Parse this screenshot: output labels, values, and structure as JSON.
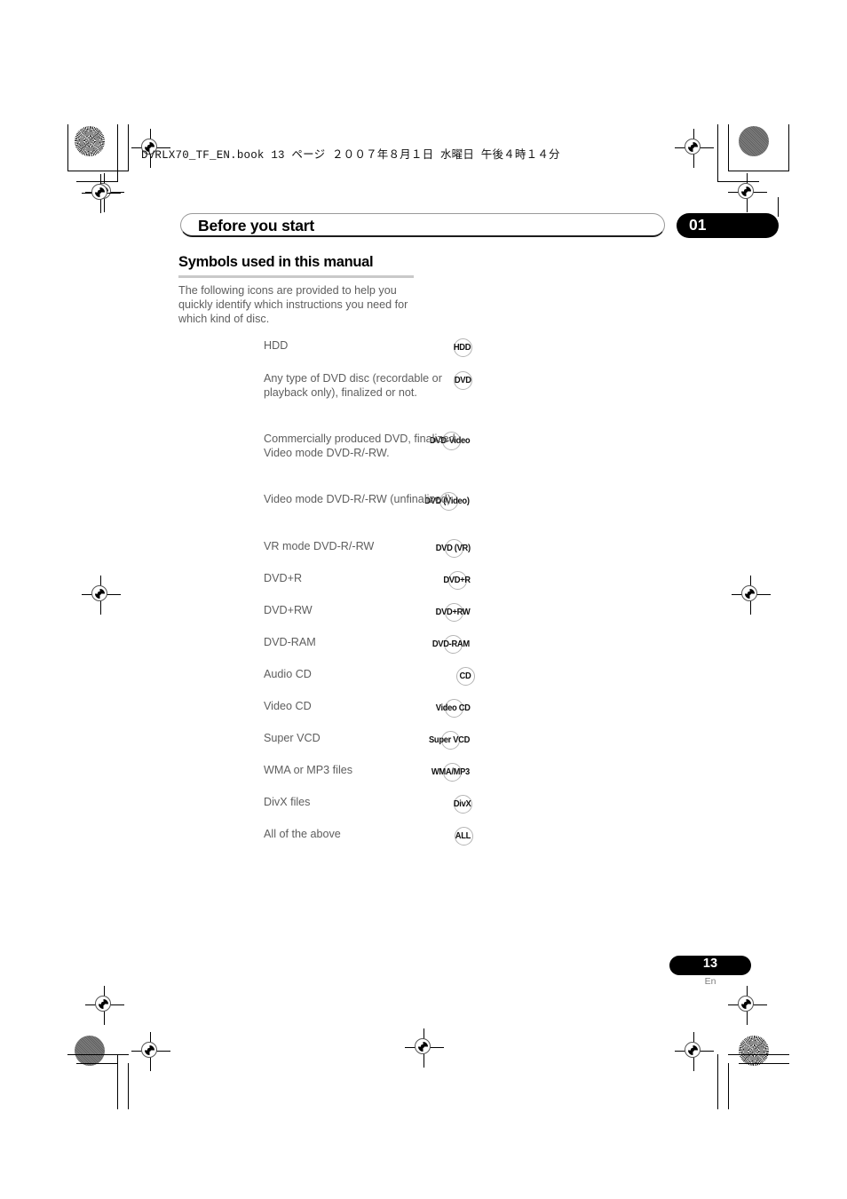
{
  "print_header": {
    "filename": "DVRLX70_TF_EN.book",
    "page_marker": "13 ページ",
    "date": "２００７年８月１日",
    "weekday": "水曜日",
    "time": "午後４時１４分",
    "full": "DVRLX70_TF_EN.book   13 ページ   ２００７年８月１日   水曜日   午後４時１４分"
  },
  "chapter": {
    "title": "Before you start",
    "number": "01"
  },
  "section": {
    "title": "Symbols used in this manual",
    "intro": "The following icons are provided to help you quickly identify which instructions you need for which kind of disc."
  },
  "symbols": [
    {
      "badge": "HDD",
      "description": "HDD"
    },
    {
      "badge": "DVD",
      "description": "Any type of DVD disc (recordable or playback only), finalized or not."
    },
    {
      "badge": "DVD-Video",
      "description": "Commercially produced DVD, finalized Video mode DVD-R/-RW."
    },
    {
      "badge": "DVD (Video)",
      "description": "Video mode DVD-R/-RW (unfinalized)"
    },
    {
      "badge": "DVD (VR)",
      "description": "VR mode DVD-R/-RW"
    },
    {
      "badge": "DVD+R",
      "description": "DVD+R"
    },
    {
      "badge": "DVD+RW",
      "description": "DVD+RW"
    },
    {
      "badge": "DVD-RAM",
      "description": "DVD-RAM"
    },
    {
      "badge": "CD",
      "description": "Audio CD"
    },
    {
      "badge": "Video CD",
      "description": "Video CD"
    },
    {
      "badge": "Super VCD",
      "description": "Super VCD"
    },
    {
      "badge": "WMA/MP3",
      "description": "WMA or MP3 files"
    },
    {
      "badge": "DivX",
      "description": "DivX files"
    },
    {
      "badge": "ALL",
      "description": "All of the above"
    }
  ],
  "footer": {
    "page_number": "13",
    "language": "En"
  },
  "colors": {
    "body_text": "#5e5e5e",
    "heading_text": "#000000",
    "tab_background": "#000000",
    "tab_text": "#ffffff",
    "rule": "#c9c9c9",
    "badge_circle": "#b4b4b4"
  }
}
